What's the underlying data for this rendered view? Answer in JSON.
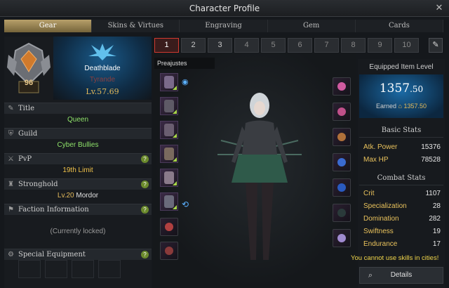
{
  "window": {
    "title": "Character Profile",
    "close": "✕"
  },
  "tabs": [
    "Gear",
    "Skins & Virtues",
    "Engraving",
    "Gem",
    "Cards"
  ],
  "character": {
    "roster_level": "96",
    "class_name": "Deathblade",
    "name": "Tyrande",
    "level": "Lv.57.69"
  },
  "sections": {
    "title": {
      "label": "Title",
      "value": "Queen"
    },
    "guild": {
      "label": "Guild",
      "value": "Cyber Bullies"
    },
    "pvp": {
      "label": "PvP",
      "value": "19th Limit"
    },
    "stronghold": {
      "label": "Stronghold",
      "level": "Lv.20",
      "name": "Mordor"
    },
    "faction": {
      "label": "Faction Information",
      "value": "(Currently locked)"
    },
    "special": {
      "label": "Special Equipment"
    },
    "help": "?"
  },
  "presets": [
    "1",
    "2",
    "3",
    "4",
    "5",
    "6",
    "7",
    "8",
    "9",
    "10"
  ],
  "preset_label": "Preajustes",
  "equipped": {
    "label": "Equipped Item Level",
    "value": "1357",
    "decimal": ".50",
    "earned_label": "Earned",
    "earned_value": "1357.50"
  },
  "basic_stats": {
    "title": "Basic Stats",
    "rows": [
      {
        "name": "Atk. Power",
        "value": "15376"
      },
      {
        "name": "Max HP",
        "value": "78528"
      }
    ]
  },
  "combat_stats": {
    "title": "Combat Stats",
    "rows": [
      {
        "name": "Crit",
        "value": "1107"
      },
      {
        "name": "Specialization",
        "value": "28"
      },
      {
        "name": "Domination",
        "value": "282"
      },
      {
        "name": "Swiftness",
        "value": "19"
      },
      {
        "name": "Endurance",
        "value": "17"
      }
    ]
  },
  "message": "You cannot use skills in cities!",
  "details_label": "Details",
  "colors": {
    "accent_gold": "#e3b95a",
    "stat_key": "#e9c25c",
    "active_preset": "#d23a30"
  }
}
